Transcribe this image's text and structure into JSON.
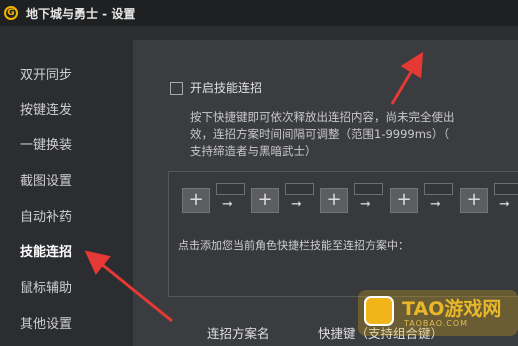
{
  "window": {
    "title": "地下城与勇士 - 设置",
    "logo_letter": "G"
  },
  "sidebar": {
    "items": [
      {
        "label": "双开同步",
        "active": false
      },
      {
        "label": "按键连发",
        "active": false
      },
      {
        "label": "一键换装",
        "active": false
      },
      {
        "label": "截图设置",
        "active": false
      },
      {
        "label": "自动补药",
        "active": false
      },
      {
        "label": "技能连招",
        "active": true
      },
      {
        "label": "鼠标辅助",
        "active": false
      },
      {
        "label": "其他设置",
        "active": false
      }
    ]
  },
  "main": {
    "enable_label": "开启技能连招",
    "enable_checked": false,
    "description": [
      "按下快捷键即可依次释放出连招内容，尚未完全使出",
      "效，连招方案时间间隔可调整（范围1-9999ms）（",
      "支持缔造者与黑暗武士）"
    ],
    "combo": {
      "key_slot_symbol": "+",
      "arrow_symbol": "➞",
      "hint": "点击添加您当前角色快捷栏技能至连招方案中："
    },
    "table_headers": {
      "scheme_name": "连招方案名",
      "hotkey": "快捷键（支持组合键）"
    }
  },
  "watermark": {
    "text": "TAO游戏网",
    "sub": "TAOBAO.COM"
  },
  "colors": {
    "background": "#2b2d30",
    "panel": "#3a3c3f",
    "titlebar": "#1f2022",
    "annotation_arrow": "#e53935",
    "logo": "#f2b300"
  }
}
